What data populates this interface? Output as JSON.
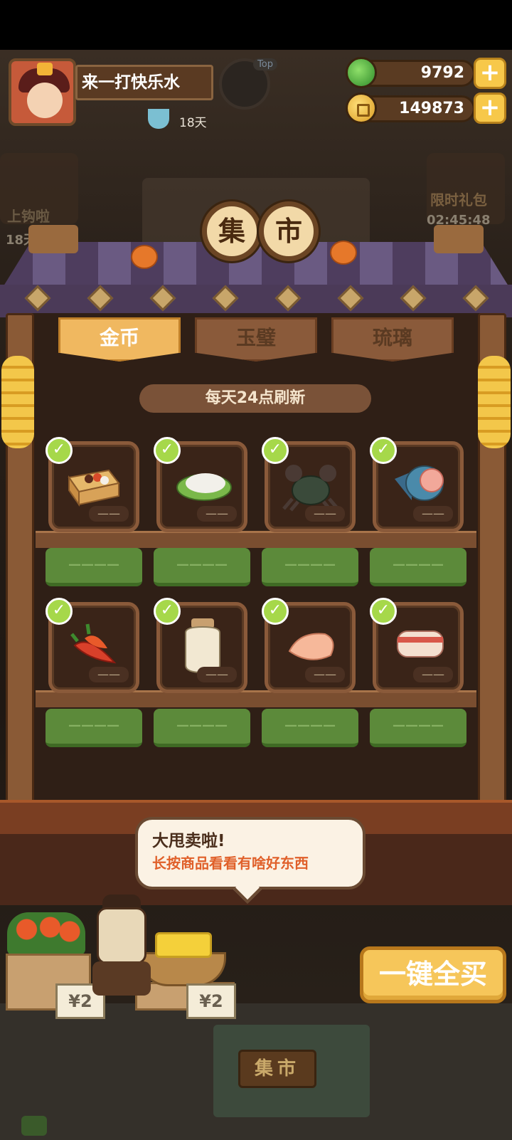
{
  "player": {
    "name": "来一打快乐水",
    "days": "18天",
    "badge": "Top"
  },
  "currency": {
    "jade": "9792",
    "gold": "149873",
    "plus": "+"
  },
  "side": {
    "left_label": "上钩啦",
    "left_days": "18天",
    "right_label": "限时礼包",
    "right_timer": "02:45:48"
  },
  "market": {
    "title_chars": [
      "集",
      "市"
    ],
    "tabs": [
      {
        "label": "金币",
        "active": true
      },
      {
        "label": "玉璧",
        "active": false
      },
      {
        "label": "琉璃",
        "active": false
      }
    ],
    "refresh_note": "每天24点刷新",
    "items": [
      {
        "icon": "bento-box-icon",
        "count": "——",
        "price": "————",
        "checked": true
      },
      {
        "icon": "rice-leaf-icon",
        "count": "——",
        "price": "————",
        "checked": true
      },
      {
        "icon": "crab-icon",
        "count": "——",
        "price": "————",
        "checked": true
      },
      {
        "icon": "fish-icon",
        "count": "——",
        "price": "————",
        "checked": true
      },
      {
        "icon": "chili-pepper-icon",
        "count": "——",
        "price": "————",
        "checked": true
      },
      {
        "icon": "sauce-jar-icon",
        "count": "——",
        "price": "————",
        "checked": true
      },
      {
        "icon": "chicken-breast-icon",
        "count": "——",
        "price": "————",
        "checked": true
      },
      {
        "icon": "pork-belly-icon",
        "count": "——",
        "price": "————",
        "checked": true
      }
    ]
  },
  "speech": {
    "line1": "大甩卖啦!",
    "line2": "长按商品看看有啥好东西"
  },
  "buy_all_label": "一键全买",
  "vendor_tags": [
    "¥2",
    "¥2"
  ],
  "scene_sign": "集市",
  "colors": {
    "tab_active": "#f0b860",
    "price_button": "#5c8a3a",
    "check": "#a6d84a",
    "buy_all": "#f6c65a",
    "speech_highlight": "#e0602a"
  }
}
